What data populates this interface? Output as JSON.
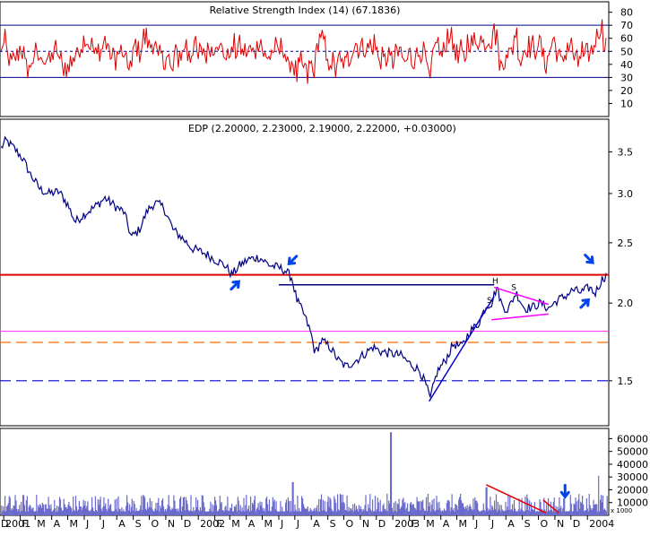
{
  "chart_data": [
    {
      "type": "line",
      "title": "Relative Strength Index (14) (67.1836)",
      "series": [
        {
          "color": "#dd0000"
        }
      ],
      "ylim": [
        0,
        88
      ],
      "yticks": [
        10,
        20,
        30,
        40,
        50,
        60,
        70,
        80
      ],
      "reference_lines": [
        70,
        50,
        30
      ]
    },
    {
      "type": "line",
      "title": "EDP (2.20000, 2.23000, 2.19000, 2.22000, +0.03000)",
      "scale": "log",
      "ylim": [
        1.27,
        3.95
      ],
      "yticks": [
        1.5,
        2.0,
        2.5,
        3.0,
        3.5
      ],
      "series": [
        {
          "color": "#000080",
          "points": [
            [
              "2000-12-27",
              3.55
            ],
            [
              "2001-01-05",
              3.65
            ],
            [
              "2001-01-20",
              3.55
            ],
            [
              "2001-02-05",
              3.42
            ],
            [
              "2001-02-20",
              3.22
            ],
            [
              "2001-03-10",
              3.05
            ],
            [
              "2001-03-25",
              3.0
            ],
            [
              "2001-04-15",
              3.02
            ],
            [
              "2001-05-01",
              2.88
            ],
            [
              "2001-05-15",
              2.7
            ],
            [
              "2001-06-01",
              2.78
            ],
            [
              "2001-06-20",
              2.85
            ],
            [
              "2001-07-10",
              2.95
            ],
            [
              "2001-08-01",
              2.85
            ],
            [
              "2001-08-15",
              2.8
            ],
            [
              "2001-08-28",
              2.55
            ],
            [
              "2001-09-12",
              2.62
            ],
            [
              "2001-09-28",
              2.82
            ],
            [
              "2001-10-12",
              2.9
            ],
            [
              "2001-10-28",
              2.85
            ],
            [
              "2001-11-15",
              2.62
            ],
            [
              "2001-12-01",
              2.55
            ],
            [
              "2001-12-20",
              2.45
            ],
            [
              "2002-01-15",
              2.4
            ],
            [
              "2002-02-01",
              2.35
            ],
            [
              "2002-02-20",
              2.3
            ],
            [
              "2002-03-05",
              2.22
            ],
            [
              "2002-03-20",
              2.3
            ],
            [
              "2002-04-05",
              2.35
            ],
            [
              "2002-04-25",
              2.37
            ],
            [
              "2002-05-15",
              2.3
            ],
            [
              "2002-06-01",
              2.28
            ],
            [
              "2002-06-12",
              2.26
            ],
            [
              "2002-06-25",
              2.2
            ],
            [
              "2002-07-05",
              2.02
            ],
            [
              "2002-07-18",
              1.92
            ],
            [
              "2002-08-01",
              1.78
            ],
            [
              "2002-08-08",
              1.66
            ],
            [
              "2002-08-20",
              1.74
            ],
            [
              "2002-09-05",
              1.7
            ],
            [
              "2002-09-20",
              1.62
            ],
            [
              "2002-10-05",
              1.58
            ],
            [
              "2002-10-25",
              1.62
            ],
            [
              "2002-11-10",
              1.66
            ],
            [
              "2002-11-25",
              1.7
            ],
            [
              "2002-12-10",
              1.67
            ],
            [
              "2002-12-28",
              1.66
            ],
            [
              "2003-01-15",
              1.65
            ],
            [
              "2003-02-01",
              1.6
            ],
            [
              "2003-02-20",
              1.56
            ],
            [
              "2003-03-05",
              1.47
            ],
            [
              "2003-03-12",
              1.4
            ],
            [
              "2003-03-25",
              1.55
            ],
            [
              "2003-04-10",
              1.62
            ],
            [
              "2003-04-25",
              1.72
            ],
            [
              "2003-05-10",
              1.7
            ],
            [
              "2003-05-25",
              1.8
            ],
            [
              "2003-06-10",
              1.85
            ],
            [
              "2003-06-25",
              1.98
            ],
            [
              "2003-07-05",
              2.0
            ],
            [
              "2003-07-15",
              2.12
            ],
            [
              "2003-07-25",
              1.98
            ],
            [
              "2003-08-05",
              1.95
            ],
            [
              "2003-08-20",
              2.08
            ],
            [
              "2003-09-05",
              1.96
            ],
            [
              "2003-09-20",
              1.97
            ],
            [
              "2003-10-05",
              2.0
            ],
            [
              "2003-10-20",
              1.96
            ],
            [
              "2003-11-05",
              2.02
            ],
            [
              "2003-11-20",
              2.05
            ],
            [
              "2003-12-05",
              2.1
            ],
            [
              "2003-12-20",
              2.08
            ],
            [
              "2004-01-05",
              2.12
            ],
            [
              "2004-01-15",
              2.07
            ],
            [
              "2004-01-28",
              2.18
            ],
            [
              "2004-02-06",
              2.22
            ]
          ]
        }
      ],
      "horizontal_lines": [
        {
          "value": 2.22,
          "color": "#e00000",
          "style": "solid"
        },
        {
          "value": 1.802,
          "color": "#ff40ff",
          "style": "solid"
        },
        {
          "value": 1.729,
          "color": "#ff6a00",
          "style": "dashed"
        },
        {
          "value": 1.5,
          "color": "#0000cc",
          "style": "dashed"
        }
      ],
      "trend_lines": [
        {
          "color": "#000080",
          "points": [
            [
              "2002-06-01",
              2.14
            ],
            [
              "2003-07-10",
              2.14
            ]
          ]
        },
        {
          "color": "#0000cc",
          "points": [
            [
              "2003-03-10",
              1.39
            ],
            [
              "2003-07-10",
              2.05
            ]
          ]
        },
        {
          "color": "#ff00ff",
          "points": [
            [
              "2003-07-10",
              2.12
            ],
            [
              "2003-10-20",
              1.99
            ]
          ]
        },
        {
          "color": "#ff00ff",
          "points": [
            [
              "2003-07-05",
              1.88
            ],
            [
              "2003-10-20",
              1.92
            ]
          ]
        }
      ],
      "annotations": [
        {
          "text": "S",
          "x": "2003-07-01",
          "y": 2.0
        },
        {
          "text": "H",
          "x": "2003-07-12",
          "y": 2.15
        },
        {
          "text": "S",
          "x": "2003-08-16",
          "y": 2.1
        }
      ]
    },
    {
      "type": "bar",
      "title": "",
      "ylim": [
        0,
        68000
      ],
      "yticks": [
        10000,
        20000,
        30000,
        40000,
        50000,
        60000
      ],
      "ytick_labels": [
        "10000",
        "20000",
        "30000",
        "40000",
        "50000",
        "60000"
      ],
      "scale_label": "x 1000",
      "volume_spikes": [
        [
          "2002-12-28",
          65000
        ],
        [
          "2002-06-28",
          26000
        ],
        [
          "2004-01-22",
          31000
        ],
        [
          "2003-06-25",
          22000
        ]
      ]
    }
  ],
  "x_axis": {
    "labels": [
      "D",
      "2001",
      "F",
      "M",
      "A",
      "M",
      "J",
      "J",
      "A",
      "S",
      "O",
      "N",
      "D",
      "2002",
      "F",
      "M",
      "A",
      "M",
      "J",
      "J",
      "A",
      "S",
      "O",
      "N",
      "D",
      "2003",
      "F",
      "M",
      "A",
      "M",
      "J",
      "J",
      "A",
      "S",
      "O",
      "N",
      "D",
      "2004"
    ]
  }
}
